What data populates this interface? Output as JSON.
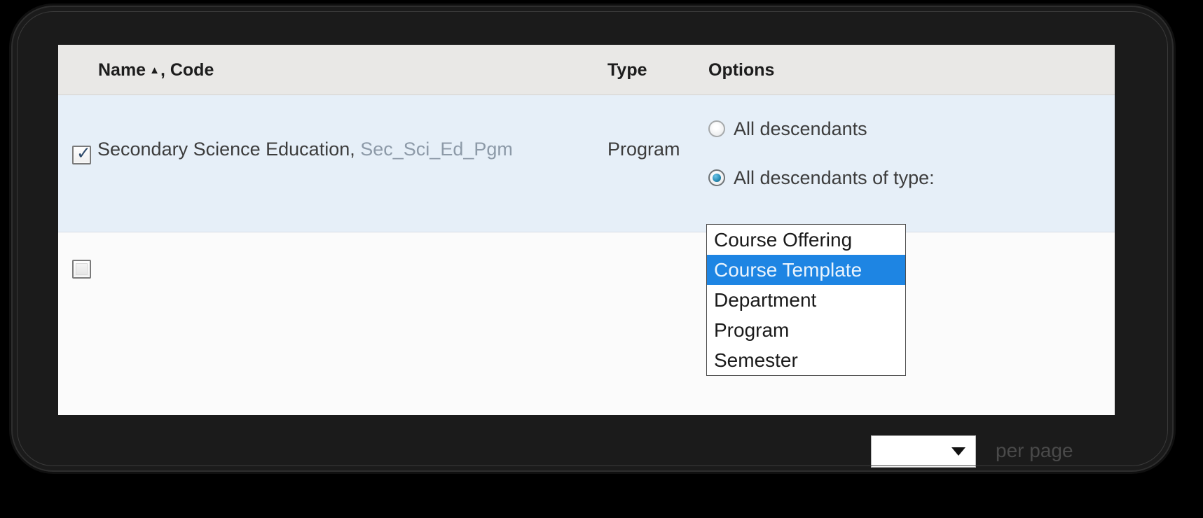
{
  "table": {
    "columns": [
      {
        "label": "Name",
        "sort_indicator": "▲",
        "suffix": ", Code"
      },
      {
        "label": "Type"
      },
      {
        "label": "Options"
      }
    ],
    "header_name_full": "Name",
    "header_name_caret": "▲",
    "header_name_suffix": ", Code",
    "header_type": "Type",
    "header_options": "Options",
    "rows": [
      {
        "checked": true,
        "name": "Secondary Science Education,",
        "code": "Sec_Sci_Ed_Pgm",
        "type": "Program",
        "options": {
          "radio_all_descendants": "All descendants",
          "radio_all_descendants_of_type": "All descendants of type:",
          "selected_radio": "all_descendants_of_type",
          "type_select_value": "Course Offering"
        }
      },
      {
        "checked": false,
        "name": "",
        "code": "",
        "type": "",
        "options": {}
      }
    ]
  },
  "dropdown": {
    "open": true,
    "selected": "Course Template",
    "options": [
      "Course Offering",
      "Course Template",
      "Department",
      "Program",
      "Semester"
    ]
  },
  "pagination": {
    "per_page_label": "per page",
    "per_page_value": ""
  },
  "icons": {
    "checkmark": "✓",
    "sort_asc": "▲",
    "chevron_down": "▼"
  },
  "colors": {
    "selected_row": "#e6eff8",
    "header_bg": "#e9e8e6",
    "dropdown_highlight": "#1e85e3",
    "code_text": "#8d9aa8",
    "radio_dot": "#2a8fb8",
    "frame": "#1b1b1b"
  }
}
